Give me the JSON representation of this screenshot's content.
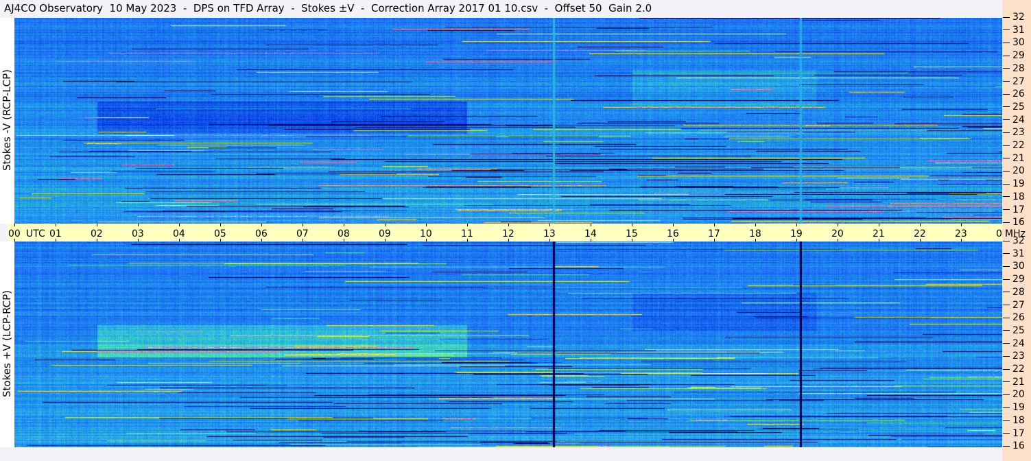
{
  "title": "AJ4CO Observatory  10 May 2023  -  DPS on TFD Array  -  Stokes ±V  -  Correction Array 2017 01 10.csv  -  Offset 50  Gain 2.0",
  "chart_data": {
    "type": "heatmap",
    "title": "AJ4CO Observatory  10 May 2023  -  DPS on TFD Array  -  Stokes ±V  -  Correction Array 2017 01 10.csv  -  Offset 50  Gain 2.0",
    "xlabel": "UTC",
    "x_unit_label": "MHz",
    "xlim": [
      0,
      24
    ],
    "x_ticks": [
      "00",
      "01",
      "02",
      "03",
      "04",
      "05",
      "06",
      "07",
      "08",
      "09",
      "10",
      "11",
      "12",
      "13",
      "14",
      "15",
      "16",
      "17",
      "18",
      "19",
      "20",
      "21",
      "22",
      "23",
      "00"
    ],
    "ylim": [
      16,
      32
    ],
    "y_ticks": [
      "32",
      "31",
      "30",
      "29",
      "28",
      "27",
      "26",
      "25",
      "24",
      "23",
      "22",
      "21",
      "20",
      "19",
      "18",
      "17",
      "16"
    ],
    "colormap": [
      "#000050",
      "#0030e0",
      "#1a66f0",
      "#22a0f0",
      "#40e0c0",
      "#c0f040",
      "#ffff00",
      "#ff40c0",
      "#ffffff"
    ],
    "panels": [
      {
        "name": "top",
        "ylabel": "Stokes -V (RCP-LCP)"
      },
      {
        "name": "bottom",
        "ylabel": "Stokes +V (LCP-RCP)"
      }
    ]
  },
  "colors": {
    "axis_band": "#ffffc0",
    "right_strip": "#fde0c8",
    "background": "#f4f4f8"
  }
}
